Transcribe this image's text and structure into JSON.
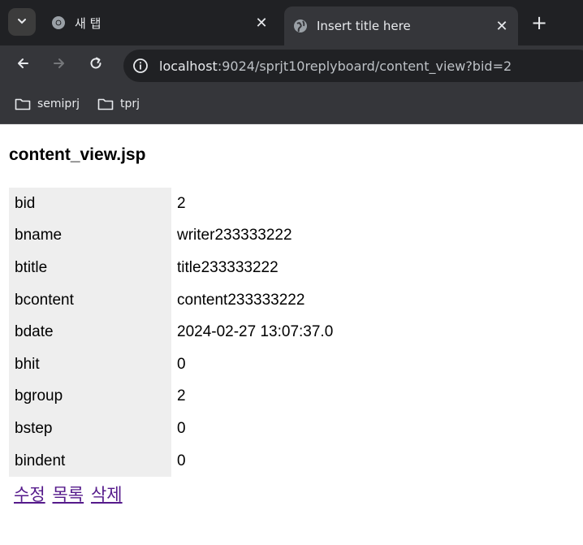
{
  "browser": {
    "tabs": [
      {
        "title": "새 탭",
        "active": false,
        "icon": "chrome-icon"
      },
      {
        "title": "Insert title here",
        "active": true,
        "icon": "globe-icon"
      }
    ],
    "url": {
      "host": "localhost",
      "path": ":9024/sprjt10replyboard/content_view?bid=2"
    },
    "bookmarks": [
      {
        "label": "semiprj",
        "icon": "folder-icon"
      },
      {
        "label": "tprj",
        "icon": "folder-icon"
      }
    ]
  },
  "page": {
    "heading": "content_view.jsp",
    "rows": [
      {
        "key": "bid",
        "value": "2"
      },
      {
        "key": "bname",
        "value": "writer233333222"
      },
      {
        "key": "btitle",
        "value": "title233333222"
      },
      {
        "key": "bcontent",
        "value": "content233333222"
      },
      {
        "key": "bdate",
        "value": "2024-02-27 13:07:37.0"
      },
      {
        "key": "bhit",
        "value": "0"
      },
      {
        "key": "bgroup",
        "value": "2"
      },
      {
        "key": "bstep",
        "value": "0"
      },
      {
        "key": "bindent",
        "value": "0"
      }
    ],
    "links": {
      "edit": "수정",
      "list": "목록",
      "delete": "삭제"
    }
  }
}
